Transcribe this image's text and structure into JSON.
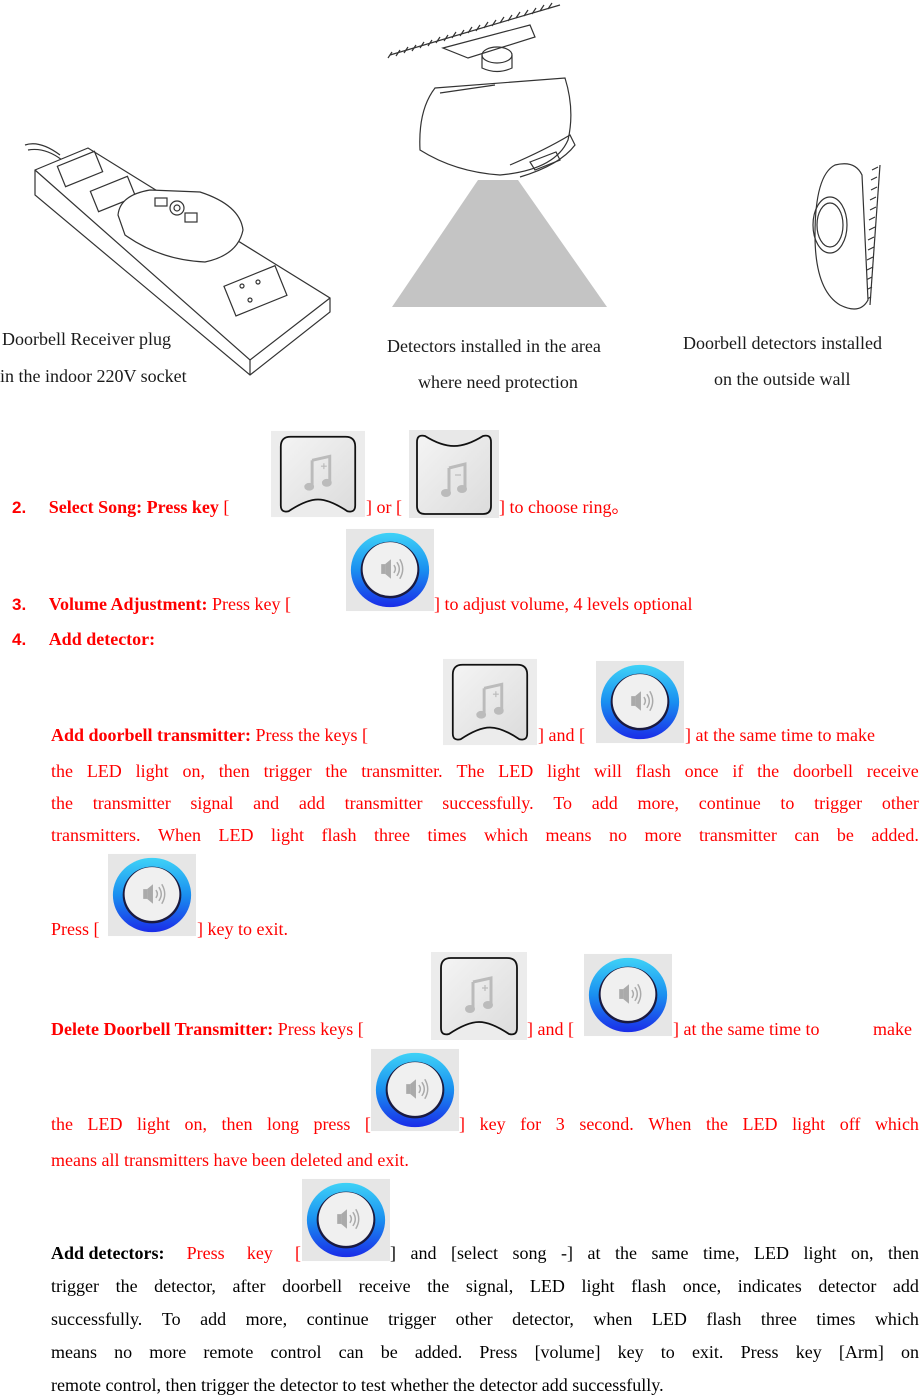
{
  "figure": {
    "captions": {
      "receiver": [
        "Doorbell Receiver plug",
        "in the indoor 220V socket"
      ],
      "detector": [
        "Detectors installed in the area",
        "where need protection"
      ],
      "outside": [
        "Doorbell detectors installed",
        "on the outside wall"
      ]
    }
  },
  "icons": {
    "song_plus": "music-note-plus-key",
    "song_minus": "music-note-minus-key",
    "volume": "speaker-volume-key"
  },
  "colors": {
    "text_red": "#ff0000",
    "ring_top": "#2ec8f5",
    "ring_bottom": "#1a2ce8"
  },
  "items": {
    "select_song": {
      "number": "2.",
      "title": "Select Song: Press key",
      "open1": "[",
      "mid": "] or [",
      "end": "] to choose ring。"
    },
    "volume": {
      "number": "3.",
      "title": "Volume Adjustment:",
      "pre": " Press key [",
      "end": "] to adjust volume, 4 levels optional"
    },
    "add_detector": {
      "number": "4.",
      "title": "Add detector:"
    }
  },
  "add_transmitter": {
    "title": "Add doorbell transmitter:",
    "pre": " Press the keys [",
    "mid": "] and [",
    "end": "] at the same time to make",
    "lines": [
      [
        "the",
        "LED",
        "light",
        "on,",
        "then",
        "trigger",
        "the",
        "transmitter.",
        "The",
        "LED",
        "light",
        "will",
        "flash",
        "once",
        "if",
        "the",
        "doorbell",
        "receive"
      ],
      [
        "the",
        "transmitter",
        "signal",
        "and",
        "add",
        "transmitter",
        "successfully.",
        "To",
        "add",
        "more,",
        "continue",
        "to",
        "trigger",
        "other"
      ],
      [
        "transmitters.",
        "When",
        "LED",
        "light",
        "flash",
        "three",
        "times",
        "which",
        "means",
        "no",
        "more",
        "transmitter",
        "can",
        "be",
        "added."
      ]
    ],
    "exit_pre": "Press [",
    "exit_end": "] key to exit."
  },
  "delete_transmitter": {
    "title": "Delete Doorbell Transmitter:",
    "pre": " Press keys [",
    "mid": "] and [",
    "end_a": "] at the same time to",
    "end_b": "make",
    "line2_pre": [
      "the",
      "LED",
      "light",
      "on,",
      "then",
      "long",
      "press",
      "["
    ],
    "line2_post": [
      "]",
      "key",
      "for",
      "3",
      "second.",
      "When",
      "the",
      "LED",
      "light",
      "off",
      "which"
    ],
    "line3": "means all transmitters have been deleted and exit."
  },
  "add_detectors": {
    "title": "Add detectors:",
    "line1_pre": [
      "Press",
      "key",
      "["
    ],
    "line1_post": [
      "]",
      "and",
      "[select",
      "song",
      "-]",
      "at",
      "the",
      "same",
      "time,",
      "LED",
      "light",
      "on,",
      "then"
    ],
    "lines": [
      [
        "trigger",
        "the",
        "detector,",
        "after",
        "doorbell",
        "receive",
        "the",
        "signal,",
        "LED",
        "light",
        "flash",
        "once,",
        "indicates",
        "detector",
        "add"
      ],
      [
        "successfully.",
        "To",
        "add",
        "more,",
        "continue",
        "trigger",
        "other",
        "detector,",
        "when",
        "LED",
        "flash",
        "three",
        "times",
        "which"
      ],
      [
        "means",
        "no",
        "more",
        "remote",
        "control",
        "can",
        "be",
        "added.",
        "Press",
        "[volume]",
        "key",
        "to",
        "exit.",
        "Press",
        "key",
        "[Arm]",
        "on"
      ]
    ],
    "last": "remote control, then trigger the detector to test whether the detector add successfully."
  }
}
